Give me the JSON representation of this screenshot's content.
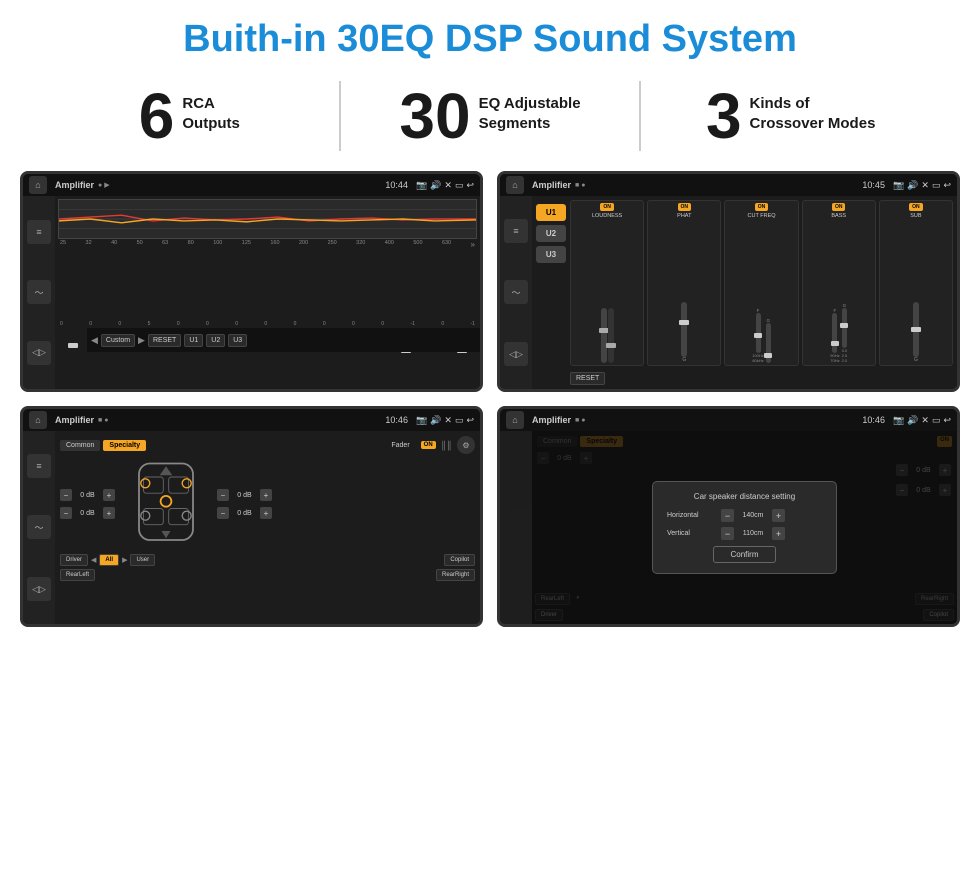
{
  "page": {
    "title": "Buith-in 30EQ DSP Sound System",
    "stats": [
      {
        "number": "6",
        "label": "RCA\nOutputs"
      },
      {
        "number": "30",
        "label": "EQ Adjustable\nSegments"
      },
      {
        "number": "3",
        "label": "Kinds of\nCrossover Modes"
      }
    ],
    "screens": [
      {
        "id": "eq-screen",
        "status": {
          "title": "Amplifier",
          "time": "10:44"
        },
        "type": "equalizer"
      },
      {
        "id": "amp2-screen",
        "status": {
          "title": "Amplifier",
          "time": "10:45"
        },
        "type": "amplifier2"
      },
      {
        "id": "cross-screen",
        "status": {
          "title": "Amplifier",
          "time": "10:46"
        },
        "type": "crossover"
      },
      {
        "id": "dialog-screen",
        "status": {
          "title": "Amplifier",
          "time": "10:46"
        },
        "type": "dialog"
      }
    ],
    "eq": {
      "frequencies": [
        "25",
        "32",
        "40",
        "50",
        "63",
        "80",
        "100",
        "125",
        "160",
        "200",
        "250",
        "320",
        "400",
        "500",
        "630"
      ],
      "values": [
        "0",
        "0",
        "0",
        "5",
        "0",
        "0",
        "0",
        "0",
        "0",
        "0",
        "0",
        "0",
        "-1",
        "0",
        "-1"
      ],
      "presets": [
        "Custom",
        "RESET",
        "U1",
        "U2",
        "U3"
      ]
    },
    "amp2": {
      "presets": [
        "U1",
        "U2",
        "U3"
      ],
      "controls": [
        {
          "label": "LOUDNESS",
          "on": true
        },
        {
          "label": "PHAT",
          "on": true
        },
        {
          "label": "CUT FREQ",
          "on": true
        },
        {
          "label": "BASS",
          "on": true
        },
        {
          "label": "SUB",
          "on": true
        }
      ],
      "reset": "RESET"
    },
    "crossover": {
      "tabs": [
        "Common",
        "Specialty"
      ],
      "fader": "Fader",
      "fader_on": "ON",
      "speaker_positions": [
        "FL",
        "FR",
        "RL",
        "RR"
      ],
      "volumes": [
        "0 dB",
        "0 dB",
        "0 dB",
        "0 dB"
      ],
      "buttons": [
        "Driver",
        "All",
        "User",
        "RearLeft",
        "RearRight",
        "Copilot"
      ]
    },
    "dialog": {
      "title": "Car speaker distance setting",
      "horizontal_label": "Horizontal",
      "horizontal_value": "140cm",
      "vertical_label": "Vertical",
      "vertical_value": "110cm",
      "confirm_label": "Confirm",
      "right_vol": [
        "0 dB",
        "0 dB"
      ],
      "tabs": [
        "Common",
        "Specialty"
      ]
    }
  }
}
